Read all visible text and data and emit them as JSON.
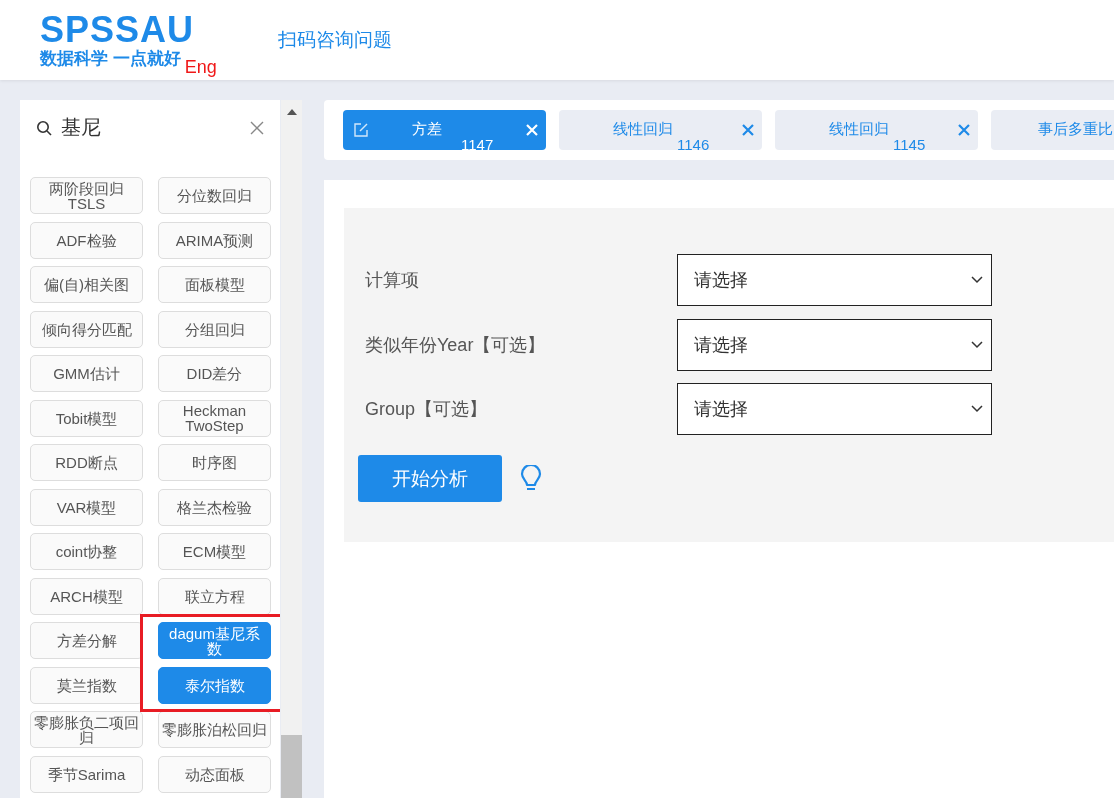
{
  "header": {
    "logo": "SPSSAU",
    "slogan": "数据科学 一点就好",
    "language_link": "Eng",
    "nav_link": "扫码咨询问题"
  },
  "sidebar": {
    "search": {
      "value": "基尼"
    },
    "highlight_selected": true,
    "items": [
      {
        "label": "两阶段回归 TSLS",
        "selected": false
      },
      {
        "label": "分位数回归",
        "selected": false
      },
      {
        "label": "ADF检验",
        "selected": false
      },
      {
        "label": "ARIMA预测",
        "selected": false
      },
      {
        "label": "偏(自)相关图",
        "selected": false
      },
      {
        "label": "面板模型",
        "selected": false
      },
      {
        "label": "倾向得分匹配",
        "selected": false
      },
      {
        "label": "分组回归",
        "selected": false
      },
      {
        "label": "GMM估计",
        "selected": false
      },
      {
        "label": "DID差分",
        "selected": false
      },
      {
        "label": "Tobit模型",
        "selected": false
      },
      {
        "label": "Heckman TwoStep",
        "selected": false
      },
      {
        "label": "RDD断点",
        "selected": false
      },
      {
        "label": "时序图",
        "selected": false
      },
      {
        "label": "VAR模型",
        "selected": false
      },
      {
        "label": "格兰杰检验",
        "selected": false
      },
      {
        "label": "coint协整",
        "selected": false
      },
      {
        "label": "ECM模型",
        "selected": false
      },
      {
        "label": "ARCH模型",
        "selected": false
      },
      {
        "label": "联立方程",
        "selected": false
      },
      {
        "label": "方差分解",
        "selected": false
      },
      {
        "label": "dagum基尼系数",
        "selected": true
      },
      {
        "label": "莫兰指数",
        "selected": false
      },
      {
        "label": "泰尔指数",
        "selected": true
      },
      {
        "label": "零膨胀负二项回归",
        "selected": false
      },
      {
        "label": "零膨胀泊松回归",
        "selected": false
      },
      {
        "label": "季节Sarima",
        "selected": false
      },
      {
        "label": "动态面板",
        "selected": false
      }
    ]
  },
  "tabs": [
    {
      "label": "方差",
      "number": "1147",
      "selected": true,
      "closable": true
    },
    {
      "label": "线性回归",
      "number": "1146",
      "selected": false,
      "closable": true
    },
    {
      "label": "线性回归",
      "number": "1145",
      "selected": false,
      "closable": true
    },
    {
      "label": "事后多重比",
      "selected": false,
      "closable": false
    }
  ],
  "form": {
    "fields": [
      {
        "label": "计算项",
        "placeholder": "请选择"
      },
      {
        "label": "类似年份Year【可选】",
        "placeholder": "请选择"
      },
      {
        "label": "Group【可选】",
        "placeholder": "请选择"
      }
    ],
    "submit": "开始分析"
  }
}
